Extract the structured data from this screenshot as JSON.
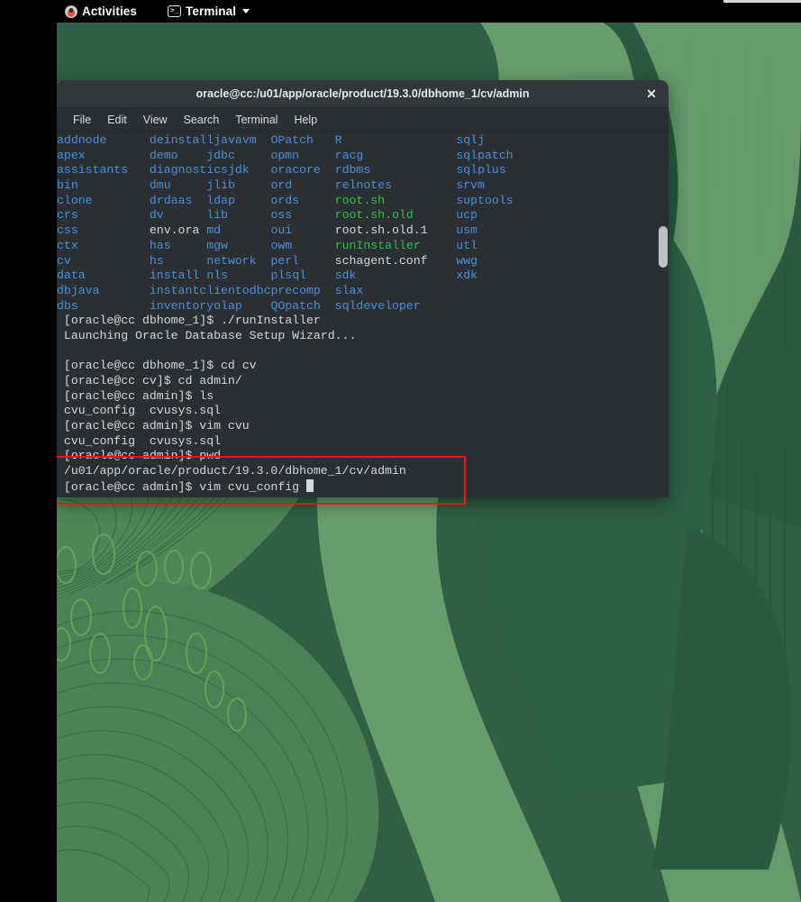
{
  "topbar": {
    "activities_label": "Activities",
    "activities_icon": "user-circle-icon",
    "app_label": "Terminal",
    "app_icon": "terminal-prompt-icon",
    "app_caret_icon": "chevron-down-icon"
  },
  "terminal": {
    "title": "oracle@cc:/u01/app/oracle/product/19.3.0/dbhome_1/cv/admin",
    "close_icon": "close-icon",
    "menu": [
      "File",
      "Edit",
      "View",
      "Search",
      "Terminal",
      "Help"
    ],
    "colors": {
      "background": "#2b2e33",
      "titlebar": "#33363b",
      "directory": "#4a90d9",
      "executable": "#2fc14a",
      "file": "#d6d7d9",
      "annotation": "#f21313"
    },
    "listing_columns": [
      [
        "addnode",
        "apex",
        "assistants",
        "bin",
        "clone",
        "crs",
        "css",
        "ctx",
        "cv",
        "data",
        "dbjava",
        "dbs"
      ],
      [
        "deinstall",
        "demo",
        "diagnostics",
        "dmu",
        "drdaas",
        "dv",
        "env.ora",
        "has",
        "hs",
        "install",
        "instantclient",
        "inventory"
      ],
      [
        "javavm",
        "jdbc",
        "jdk",
        "jlib",
        "ldap",
        "lib",
        "md",
        "mgw",
        "network",
        "nls",
        "odbc",
        "olap"
      ],
      [
        "OPatch",
        "opmn",
        "oracore",
        "ord",
        "ords",
        "oss",
        "oui",
        "owm",
        "perl",
        "plsql",
        "precomp",
        "QOpatch"
      ],
      [
        "R",
        "racg",
        "rdbms",
        "relnotes",
        "root.sh",
        "root.sh.old",
        "root.sh.old.1",
        "runInstaller",
        "schagent.conf",
        "sdk",
        "slax",
        "sqldeveloper"
      ],
      [
        "sqlj",
        "sqlpatch",
        "sqlplus",
        "srvm",
        "suptools",
        "ucp",
        "usm",
        "utl",
        "wwg",
        "xdk",
        "",
        ""
      ]
    ],
    "listing_types": [
      [
        "dir",
        "dir",
        "dir",
        "dir",
        "dir",
        "dir",
        "dir",
        "dir",
        "dir",
        "dir",
        "dir",
        "dir"
      ],
      [
        "dir",
        "dir",
        "dir",
        "dir",
        "dir",
        "dir",
        "file",
        "dir",
        "dir",
        "dir",
        "dir",
        "dir"
      ],
      [
        "dir",
        "dir",
        "dir",
        "dir",
        "dir",
        "dir",
        "dir",
        "dir",
        "dir",
        "dir",
        "dir",
        "dir"
      ],
      [
        "dir",
        "dir",
        "dir",
        "dir",
        "dir",
        "dir",
        "dir",
        "dir",
        "dir",
        "dir",
        "dir",
        "dir"
      ],
      [
        "dir",
        "dir",
        "dir",
        "dir",
        "exe",
        "exe",
        "file",
        "exe",
        "file",
        "dir",
        "dir",
        "dir"
      ],
      [
        "dir",
        "dir",
        "dir",
        "dir",
        "dir",
        "dir",
        "dir",
        "dir",
        "dir",
        "dir",
        "none",
        "none"
      ]
    ],
    "session_lines": [
      "[oracle@cc dbhome_1]$ ./runInstaller",
      "Launching Oracle Database Setup Wizard...",
      "",
      "[oracle@cc dbhome_1]$ cd cv",
      "[oracle@cc cv]$ cd admin/",
      "[oracle@cc admin]$ ls",
      "cvu_config  cvusys.sql",
      "[oracle@cc admin]$ vim cvu",
      "cvu_config  cvusys.sql",
      "[oracle@cc admin]$ pwd",
      "/u01/app/oracle/product/19.3.0/dbhome_1/cv/admin",
      "[oracle@cc admin]$ vim cvu_config "
    ]
  },
  "annotation": {
    "name": "red-highlight-box",
    "color": "#f21313"
  }
}
